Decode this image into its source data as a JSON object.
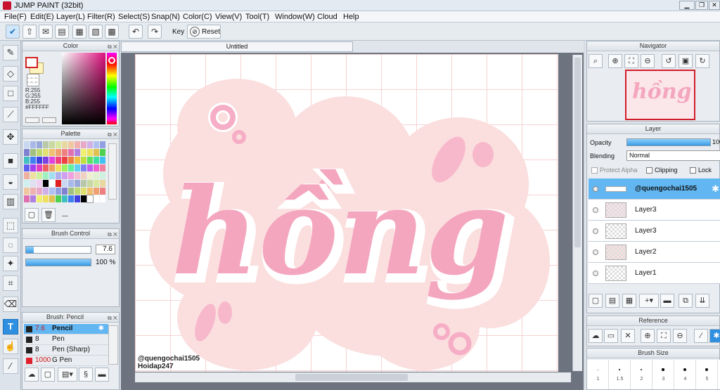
{
  "app": {
    "title": "JUMP PAINT (32bit)"
  },
  "menu": [
    "File(F)",
    "Edit(E)",
    "Layer(L)",
    "Filter(R)",
    "Select(S)",
    "Snap(N)",
    "Color(C)",
    "View(V)",
    "Tool(T)",
    "Window(W)",
    "Cloud",
    "Help"
  ],
  "toolbar": {
    "key_label": "Key",
    "reset_label": "Reset"
  },
  "document": {
    "tab": "Untitled"
  },
  "color": {
    "title": "Color",
    "r": "R:255",
    "g": "G:255",
    "b": "B:255",
    "hex": "#FFFFFF",
    "fg": "#ffffff",
    "bg": "#fff4c0"
  },
  "palette": {
    "title": "Palette",
    "footer": "---"
  },
  "brush_control": {
    "title": "Brush Control",
    "size": "7.6",
    "opacity": "100 %",
    "size_fill": 0.12,
    "opacity_fill": 1.0
  },
  "brushes": {
    "title": "Brush: Pencil",
    "items": [
      {
        "size": "7.6",
        "name": "Pencil",
        "selected": true,
        "color": "#222222"
      },
      {
        "size": "8",
        "name": "Pen",
        "selected": false,
        "color": "#222222"
      },
      {
        "size": "8",
        "name": "Pen (Sharp)",
        "selected": false,
        "color": "#222222"
      },
      {
        "size": "1000",
        "name": "G Pen",
        "selected": false,
        "color": "#e0202a"
      }
    ]
  },
  "artwork": {
    "word": "hồng",
    "credit1": "@quengochai1505",
    "credit2": "Hoidap247"
  },
  "navigator": {
    "title": "Navigator",
    "preview_word": "hồng"
  },
  "layer_panel": {
    "title": "Layer",
    "opacity_label": "Opacity",
    "opacity_value": "100",
    "blending_label": "Blending",
    "blending_value": "Normal",
    "protect_alpha": "Protect Alpha",
    "clipping": "Clipping",
    "lock": "Lock",
    "layers": [
      {
        "name": "@quengochai1505",
        "selected": true
      },
      {
        "name": "Layer3",
        "selected": false
      },
      {
        "name": "Layer3",
        "selected": false
      },
      {
        "name": "Layer2",
        "selected": false
      },
      {
        "name": "Layer1",
        "selected": false
      }
    ]
  },
  "reference": {
    "title": "Reference"
  },
  "brush_size": {
    "title": "Brush Size",
    "labels": [
      "1",
      "1.5",
      "2",
      "3",
      "4",
      "5"
    ]
  }
}
